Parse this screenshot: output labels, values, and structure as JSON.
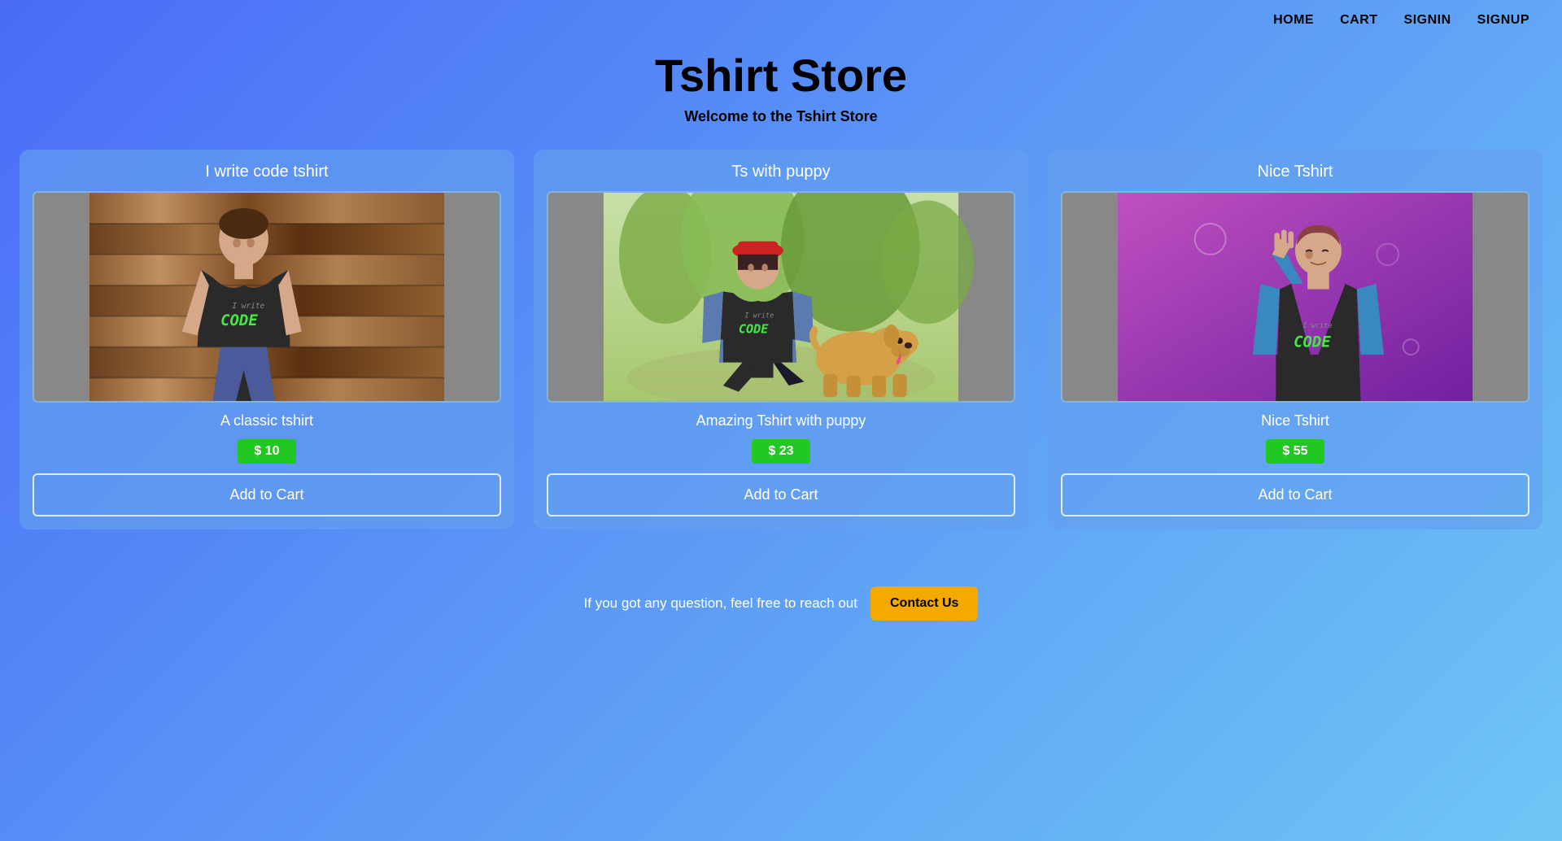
{
  "nav": {
    "links": [
      {
        "label": "HOME",
        "href": "#"
      },
      {
        "label": "CART",
        "href": "#"
      },
      {
        "label": "SIGNIN",
        "href": "#"
      },
      {
        "label": "SIGNUP",
        "href": "#"
      }
    ]
  },
  "header": {
    "title": "Tshirt Store",
    "subtitle": "Welcome to the Tshirt Store"
  },
  "products": [
    {
      "id": "product-1",
      "card_title": "I write code tshirt",
      "description": "A classic tshirt",
      "price": "$ 10",
      "add_to_cart_label": "Add to Cart",
      "image_bg": "#8a5a30",
      "image_theme": "wood"
    },
    {
      "id": "product-2",
      "card_title": "Ts with puppy",
      "description": "Amazing Tshirt with puppy",
      "price": "$ 23",
      "add_to_cart_label": "Add to Cart",
      "image_bg": "#90b860",
      "image_theme": "park"
    },
    {
      "id": "product-3",
      "card_title": "Nice Tshirt",
      "description": "Nice Tshirt",
      "price": "$ 55",
      "add_to_cart_label": "Add to Cart",
      "image_bg": "#a030c0",
      "image_theme": "purple"
    }
  ],
  "footer": {
    "text": "If you got any question, feel free to reach out",
    "contact_label": "Contact Us"
  }
}
